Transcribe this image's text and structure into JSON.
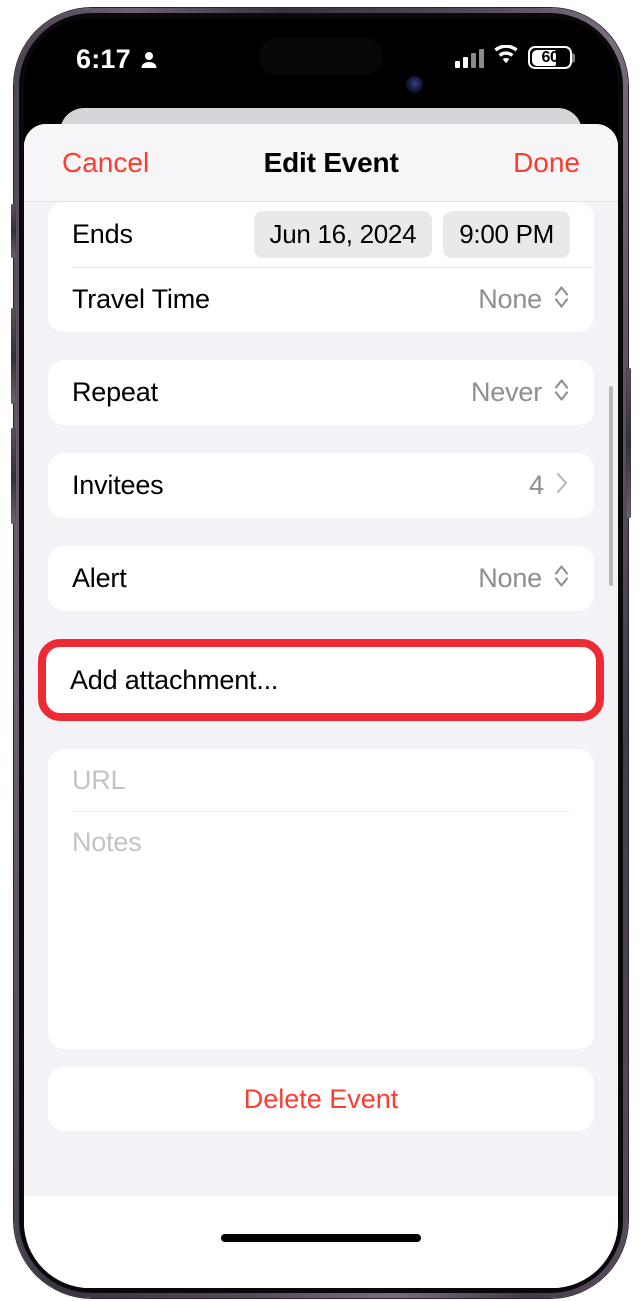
{
  "status_bar": {
    "time": "6:17",
    "person_icon": "person-icon",
    "signal_icon": "cellular-signal-icon",
    "wifi_icon": "wifi-icon",
    "battery_level": "60",
    "battery_percent": 60
  },
  "nav": {
    "cancel_label": "Cancel",
    "title": "Edit Event",
    "done_label": "Done",
    "accent_color": "#ff3b30"
  },
  "form": {
    "ends": {
      "label": "Ends",
      "date_value": "Jun 16, 2024",
      "time_value": "9:00 PM"
    },
    "travel_time": {
      "label": "Travel Time",
      "value": "None"
    },
    "repeat": {
      "label": "Repeat",
      "value": "Never"
    },
    "invitees": {
      "label": "Invitees",
      "value": "4"
    },
    "alert": {
      "label": "Alert",
      "value": "None"
    },
    "add_attachment": {
      "label": "Add attachment...",
      "highlight_color": "#ee2a35"
    },
    "url_field": {
      "placeholder": "URL",
      "value": ""
    },
    "notes_field": {
      "placeholder": "Notes",
      "value": ""
    },
    "delete_event": {
      "label": "Delete Event"
    }
  }
}
